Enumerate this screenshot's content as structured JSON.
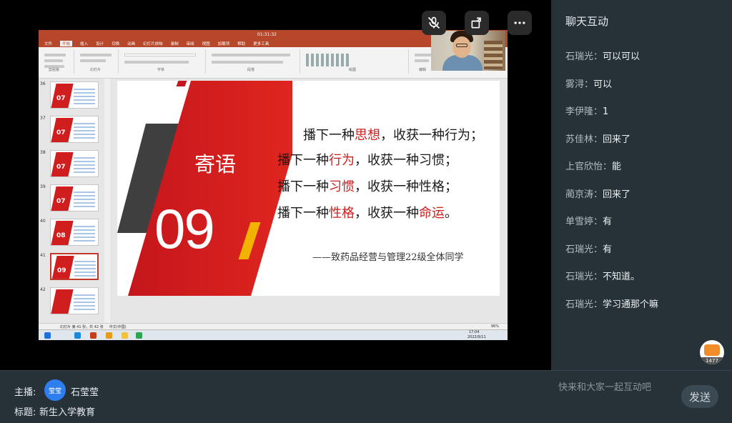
{
  "colors": {
    "panel": "#263238",
    "accent_red": "#d01e1e",
    "send_button": "#3b4a52",
    "avatar": "#2f7ef0"
  },
  "ppt": {
    "titlebar_time": "01:31:32",
    "menus": [
      "文件",
      "开始",
      "插入",
      "设计",
      "切换",
      "动画",
      "幻灯片放映",
      "录制",
      "审阅",
      "视图",
      "加载项",
      "帮助",
      "更多工具"
    ],
    "ribbon_groups": [
      "剪贴板",
      "幻灯片",
      "字体",
      "段落",
      "绘图",
      "编辑"
    ],
    "status_left": "幻灯片 第 41 张，共 42 张",
    "status_lang": "中文(中国)",
    "zoom": "96%",
    "clock": "17:04",
    "date": "2022/9/11",
    "thumbnails": [
      {
        "num": "36",
        "label": "07"
      },
      {
        "num": "37",
        "label": "07"
      },
      {
        "num": "38",
        "label": "07"
      },
      {
        "num": "39",
        "label": "07"
      },
      {
        "num": "40",
        "label": "08"
      },
      {
        "num": "41",
        "label": "09"
      },
      {
        "num": "42",
        "label": ""
      }
    ],
    "slide": {
      "title": "寄语",
      "number": "09",
      "lines": [
        {
          "a": "播下一种",
          "b": "思想",
          "c": "，收获一种行为；",
          "d": ""
        },
        {
          "a": "播下一种",
          "b": "行为",
          "c": "，收获一种习惯；",
          "d": ""
        },
        {
          "a": "播下一种",
          "b": "习惯",
          "c": "，收获一种性格；",
          "d": ""
        },
        {
          "a": "播下一种",
          "b": "性格",
          "c": "，收获一种",
          "d": "命运",
          "e": "。"
        }
      ],
      "signature": "——致药品经营与管理22级全体同学"
    }
  },
  "top_buttons": [
    "no-mic-icon",
    "rotate-icon",
    "more-icon"
  ],
  "chat": {
    "title": "聊天互动",
    "messages": [
      {
        "name": "石瑞光：",
        "text": "可以可以"
      },
      {
        "name": "雾浔：",
        "text": "可以"
      },
      {
        "name": "李伊隆：",
        "text": "1"
      },
      {
        "name": "苏佳林：",
        "text": "回来了"
      },
      {
        "name": "上官欣怡：",
        "text": "能"
      },
      {
        "name": "蔺京涛：",
        "text": "回来了"
      },
      {
        "name": "单雪婷：",
        "text": "有"
      },
      {
        "name": "石瑞光：",
        "text": "有"
      },
      {
        "name": "石瑞光：",
        "text": "不知道。"
      },
      {
        "name": "石瑞光：",
        "text": "学习通那个嘛"
      }
    ],
    "like_count": "1477",
    "input_placeholder": "快来和大家一起互动吧",
    "send_label": "发送"
  },
  "host": {
    "host_label": "主播:",
    "avatar_text": "莹莹",
    "host_name": "石莹莹",
    "topic_label": "标题:",
    "topic": "新生入学教育"
  }
}
